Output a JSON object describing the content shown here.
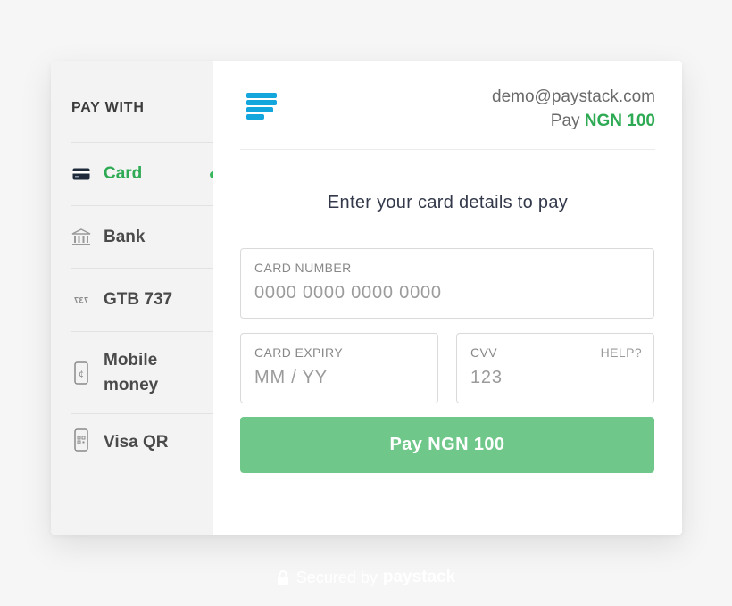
{
  "sidebar": {
    "heading": "PAY WITH",
    "items": [
      {
        "label": "Card",
        "icon": "credit-card-icon",
        "active": true
      },
      {
        "label": "Bank",
        "icon": "bank-icon",
        "active": false
      },
      {
        "label": "GTB 737",
        "icon": "ussd-737-icon",
        "icon_text": "737",
        "active": false
      },
      {
        "label": "Mobile money",
        "icon": "mobile-money-icon",
        "active": false
      },
      {
        "label": "Visa QR",
        "icon": "qr-phone-icon",
        "active": false
      }
    ]
  },
  "header": {
    "email": "demo@paystack.com",
    "pay_prefix": "Pay",
    "amount": "NGN 100"
  },
  "form": {
    "prompt": "Enter your card details to pay",
    "card_number": {
      "label": "CARD NUMBER",
      "placeholder": "0000 0000 0000 0000",
      "value": ""
    },
    "card_expiry": {
      "label": "CARD EXPIRY",
      "placeholder": "MM / YY",
      "value": ""
    },
    "cvv": {
      "label": "CVV",
      "placeholder": "123",
      "value": "",
      "help": "HELP?"
    },
    "pay_button": "Pay NGN 100"
  },
  "footer": {
    "secured_text": "Secured by",
    "brand": "paystack"
  },
  "colors": {
    "accent_green": "#2eaa54",
    "button_green": "#6fc78a",
    "logo_blue": "#13a6dd",
    "sidebar_bg": "#f3f3f3"
  }
}
